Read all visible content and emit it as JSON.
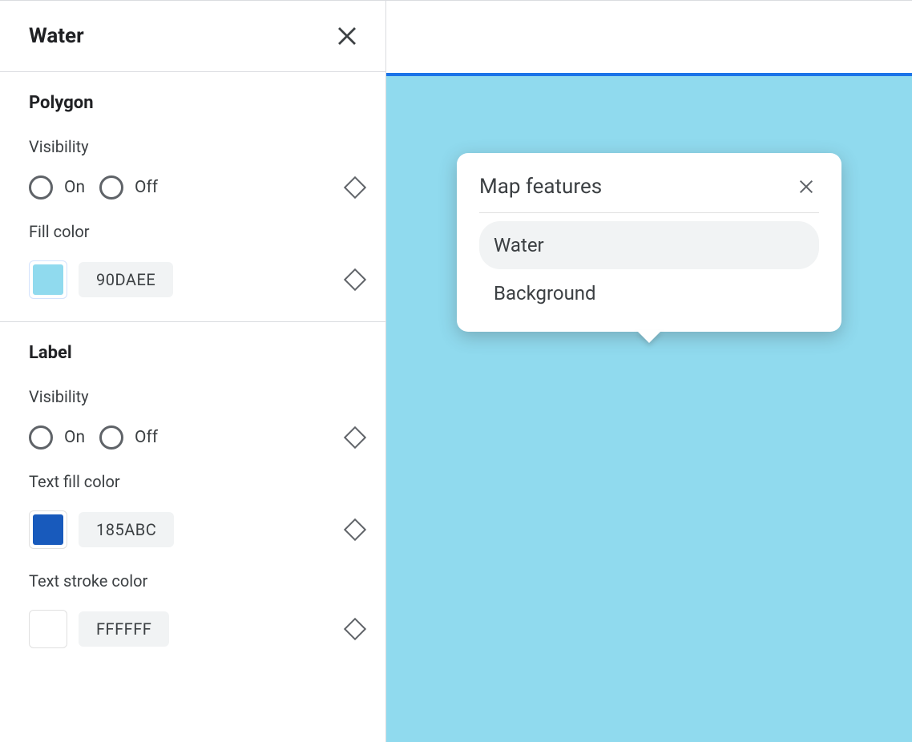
{
  "sidebar": {
    "title": "Water",
    "polygon": {
      "heading": "Polygon",
      "visibility_label": "Visibility",
      "on_label": "On",
      "off_label": "Off",
      "fill_color_label": "Fill color",
      "fill_color_hex": "90DAEE",
      "fill_color_css": "#90DAEE"
    },
    "label": {
      "heading": "Label",
      "visibility_label": "Visibility",
      "on_label": "On",
      "off_label": "Off",
      "text_fill_label": "Text fill color",
      "text_fill_hex": "185ABC",
      "text_fill_css": "#185ABC",
      "text_stroke_label": "Text stroke color",
      "text_stroke_hex": "FFFFFF",
      "text_stroke_css": "#FFFFFF"
    }
  },
  "preview": {
    "water_css": "#90DAEE",
    "accent_css": "#1a73e8"
  },
  "popover": {
    "title": "Map features",
    "items": [
      {
        "label": "Water",
        "selected": true
      },
      {
        "label": "Background",
        "selected": false
      }
    ]
  }
}
